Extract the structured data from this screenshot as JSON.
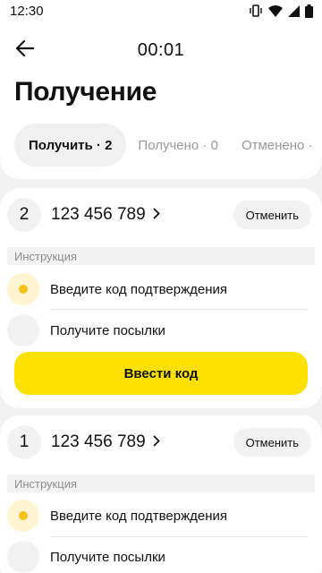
{
  "status_bar": {
    "time": "12:30",
    "icons": [
      "vibrate-icon",
      "wifi-icon",
      "signal-icon",
      "battery-icon"
    ]
  },
  "header": {
    "back_icon": "arrow-left-icon",
    "timer": "00:01"
  },
  "page": {
    "title": "Получение"
  },
  "tabs": [
    {
      "label": "Получить · 2",
      "active": true
    },
    {
      "label": "Получено · 0",
      "active": false
    },
    {
      "label": "Отменено ·",
      "active": false
    }
  ],
  "orders": [
    {
      "number": "2",
      "phone": "123 456 789",
      "cancel_label": "Отменить",
      "instruction_label": "Инструкция",
      "steps": [
        {
          "text": "Введите код подтверждения",
          "current": true
        },
        {
          "text": "Получите посылки",
          "current": false
        }
      ],
      "action_label": "Ввести код"
    },
    {
      "number": "1",
      "phone": "123 456 789",
      "cancel_label": "Отменить",
      "instruction_label": "Инструкция",
      "steps": [
        {
          "text": "Введите код подтверждения",
          "current": true
        },
        {
          "text": "Получите посылки",
          "current": false
        }
      ]
    }
  ],
  "colors": {
    "accent": "#fce000",
    "step_dot": "#f5c21b",
    "background": "#f2f2f2"
  }
}
